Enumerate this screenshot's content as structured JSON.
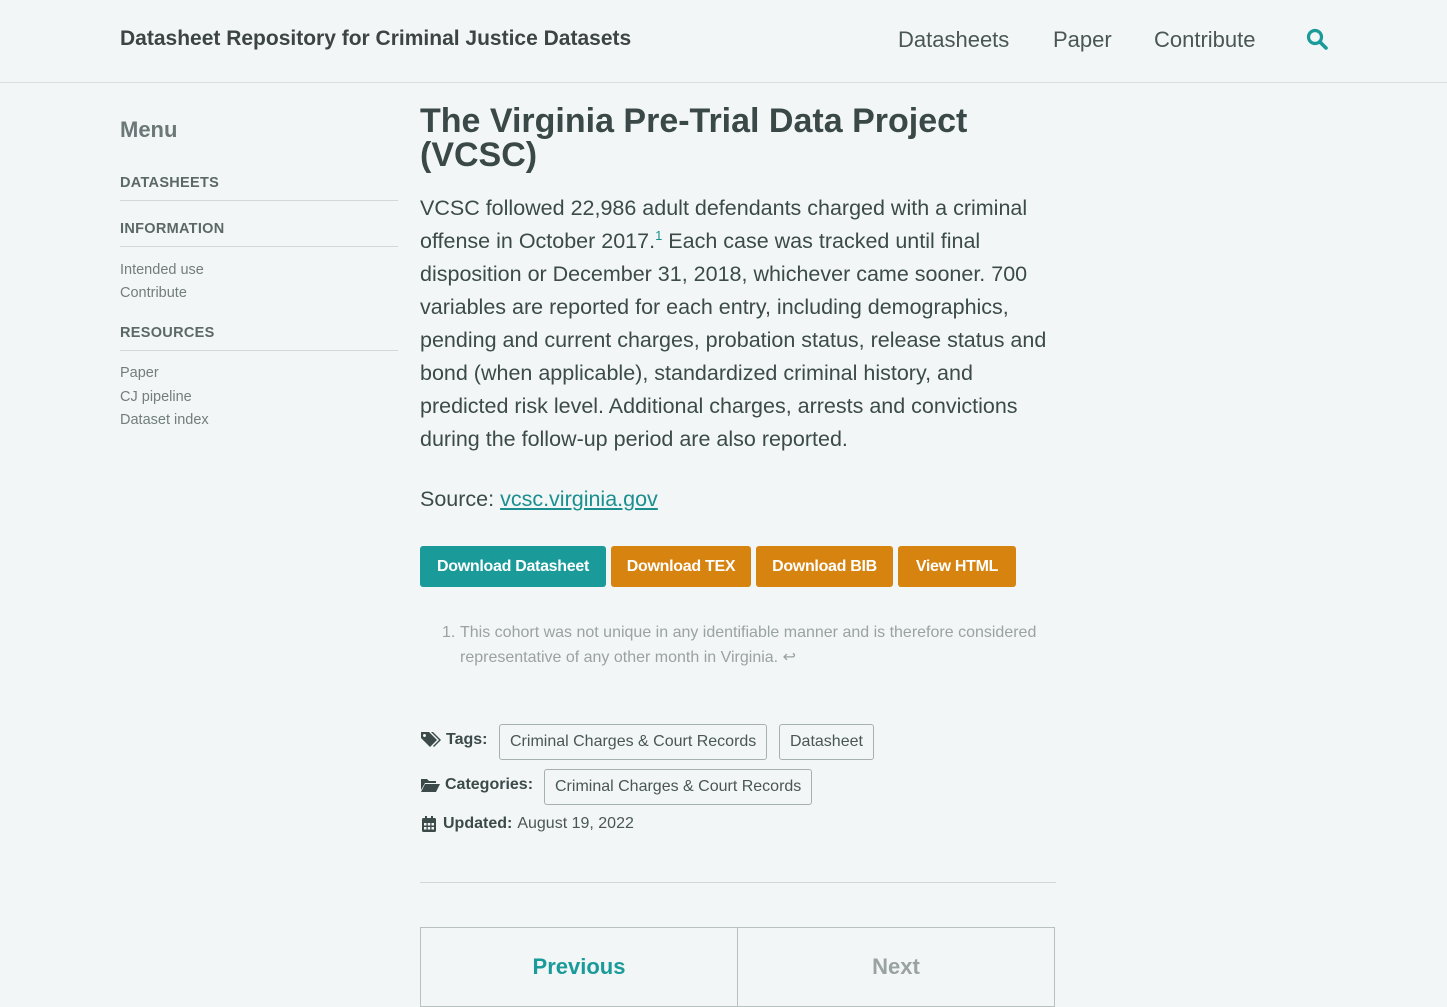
{
  "header": {
    "site_title": "Datasheet Repository for Criminal Justice Datasets",
    "nav": [
      "Datasheets",
      "Paper",
      "Contribute"
    ],
    "search_icon": "search-icon"
  },
  "sidebar": {
    "title": "Menu",
    "sections": [
      {
        "label": "DATASHEETS",
        "items": []
      },
      {
        "label": "INFORMATION",
        "items": [
          "Intended use",
          "Contribute"
        ]
      },
      {
        "label": "RESOURCES",
        "items": [
          "Paper",
          "CJ pipeline",
          "Dataset index"
        ]
      }
    ]
  },
  "main": {
    "title": "The Virginia Pre-Trial Data Project (VCSC)",
    "desc_before": "VCSC followed 22,986 adult defendants charged with a criminal offense in October 2017.",
    "footnote_ref": "1",
    "desc_after": " Each case was tracked until final disposition or December 31, 2018, whichever came sooner. 700 variables are reported for each entry, including demographics, pending and current charges, probation status, release status and bond (when applicable), standardized criminal history, and predicted risk level. Additional charges, arrests and convictions during the follow-up period are also reported.",
    "source_label": "Source: ",
    "source_link": "vcsc.virginia.gov",
    "buttons": [
      "Download Datasheet",
      "Download TEX",
      "Download BIB",
      "View HTML"
    ],
    "footnote": {
      "number": "1.",
      "text": "This cohort was not unique in any identifiable manner and is therefore considered representative of any other month in Virginia.",
      "backref": "↩"
    },
    "tags_label": "Tags:",
    "tags": [
      "Criminal Charges & Court Records",
      "Datasheet"
    ],
    "categories_label": "Categories:",
    "categories": [
      "Criminal Charges & Court Records"
    ],
    "updated_label": "Updated:",
    "updated_value": "August 19, 2022",
    "pager": {
      "previous": "Previous",
      "next": "Next"
    }
  },
  "colors": {
    "background": "#f2f6f6",
    "accent": "#1b9a9a",
    "orange": "#d7830f",
    "pager_disabled": "#9aa2a2"
  }
}
